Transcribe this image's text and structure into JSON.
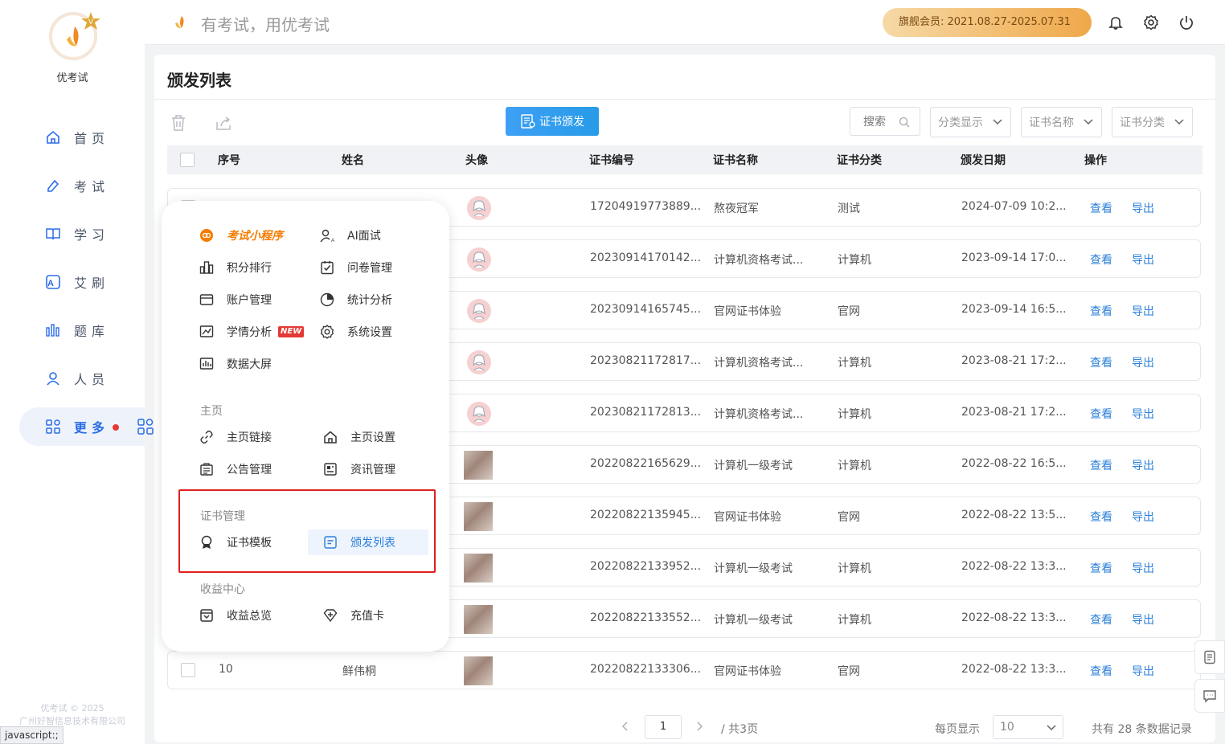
{
  "app": {
    "name": "优考试",
    "slogan": "有考试，用优考试",
    "copyright_line1": "优考试 © 2025",
    "copyright_line2": "广州好智信息技术有限公司"
  },
  "member": {
    "label": "旗舰会员: 2021.08.27-2025.07.31"
  },
  "status_bar": "javascript:;",
  "sidebar": {
    "items": [
      {
        "label": "首页",
        "icon": "home-icon"
      },
      {
        "label": "考试",
        "icon": "exam-icon"
      },
      {
        "label": "学习",
        "icon": "book-icon"
      },
      {
        "label": "艾刷",
        "icon": "practice-icon"
      },
      {
        "label": "题库",
        "icon": "question-bank-icon"
      },
      {
        "label": "人员",
        "icon": "user-icon"
      },
      {
        "label": "更多",
        "icon": "more-grid-icon",
        "active": true
      }
    ]
  },
  "page": {
    "title": "颁发列表"
  },
  "toolbar": {
    "issue_label": "证书颁发",
    "search_label": "搜索",
    "filters": [
      "分类显示",
      "证书名称",
      "证书分类"
    ]
  },
  "table": {
    "headers": [
      "序号",
      "姓名",
      "头像",
      "证书编号",
      "证书名称",
      "证书分类",
      "颁发日期",
      "操作"
    ],
    "view_label": "查看",
    "export_label": "导出",
    "rows": [
      {
        "no": "",
        "name": "",
        "cert_no": "17204919773889...",
        "cert_name": "熬夜冠军",
        "category": "测试",
        "date": "2024-07-09 10:2..."
      },
      {
        "no": "",
        "name": "",
        "cert_no": "20230914170142...",
        "cert_name": "计算机资格考试...",
        "category": "计算机",
        "date": "2023-09-14 17:0..."
      },
      {
        "no": "",
        "name": "",
        "cert_no": "20230914165745...",
        "cert_name": "官网证书体验",
        "category": "官网",
        "date": "2023-09-14 16:5..."
      },
      {
        "no": "",
        "name": "",
        "cert_no": "20230821172817...",
        "cert_name": "计算机资格考试...",
        "category": "计算机",
        "date": "2023-08-21 17:2..."
      },
      {
        "no": "",
        "name": "",
        "cert_no": "20230821172813...",
        "cert_name": "计算机资格考试...",
        "category": "计算机",
        "date": "2023-08-21 17:2..."
      },
      {
        "no": "",
        "name": "",
        "cert_no": "20220822165629...",
        "cert_name": "计算机一级考试",
        "category": "计算机",
        "date": "2022-08-22 16:5..."
      },
      {
        "no": "",
        "name": "",
        "cert_no": "20220822135945...",
        "cert_name": "官网证书体验",
        "category": "官网",
        "date": "2022-08-22 13:5..."
      },
      {
        "no": "",
        "name": "",
        "cert_no": "20220822133952...",
        "cert_name": "计算机一级考试",
        "category": "计算机",
        "date": "2022-08-22 13:3..."
      },
      {
        "no": "",
        "name": "",
        "cert_no": "20220822133552...",
        "cert_name": "计算机一级考试",
        "category": "计算机",
        "date": "2022-08-22 13:3..."
      },
      {
        "no": "10",
        "name": "鲜伟桐",
        "cert_no": "20220822133306...",
        "cert_name": "官网证书体验",
        "category": "官网",
        "date": "2022-08-22 13:3..."
      }
    ]
  },
  "pagination": {
    "current": "1",
    "total_pages": "/ 共3页",
    "per_page_label": "每页显示",
    "per_page": "10",
    "total_records": "共有 28 条数据记录"
  },
  "popup": {
    "top_items": [
      {
        "label": "考试小程序",
        "icon": "mini-program-icon"
      },
      {
        "label": "AI面试",
        "icon": "ai-interview-icon"
      },
      {
        "label": "积分排行",
        "icon": "ranking-icon"
      },
      {
        "label": "问卷管理",
        "icon": "survey-icon"
      },
      {
        "label": "账户管理",
        "icon": "account-icon"
      },
      {
        "label": "统计分析",
        "icon": "statistics-icon"
      },
      {
        "label": "学情分析",
        "icon": "learning-analysis-icon",
        "badge": "NEW"
      },
      {
        "label": "系统设置",
        "icon": "settings-icon"
      },
      {
        "label": "数据大屏",
        "icon": "dashboard-icon"
      }
    ],
    "sections": [
      {
        "title": "主页",
        "items": [
          {
            "label": "主页链接",
            "icon": "link-icon"
          },
          {
            "label": "主页设置",
            "icon": "home-settings-icon"
          },
          {
            "label": "公告管理",
            "icon": "announcement-icon"
          },
          {
            "label": "资讯管理",
            "icon": "news-icon"
          }
        ]
      },
      {
        "title": "证书管理",
        "items": [
          {
            "label": "证书模板",
            "icon": "certificate-template-icon"
          },
          {
            "label": "颁发列表",
            "icon": "issue-list-icon",
            "active": true
          }
        ]
      },
      {
        "title": "收益中心",
        "items": [
          {
            "label": "收益总览",
            "icon": "revenue-icon"
          },
          {
            "label": "充值卡",
            "icon": "recharge-card-icon"
          }
        ]
      }
    ]
  },
  "colors": {
    "accent": "#2b6de8",
    "link": "#2b7fd8",
    "issue_button": "#279be8",
    "highlight_frame": "#e02020",
    "member_gradient_end": "#efa84a"
  }
}
